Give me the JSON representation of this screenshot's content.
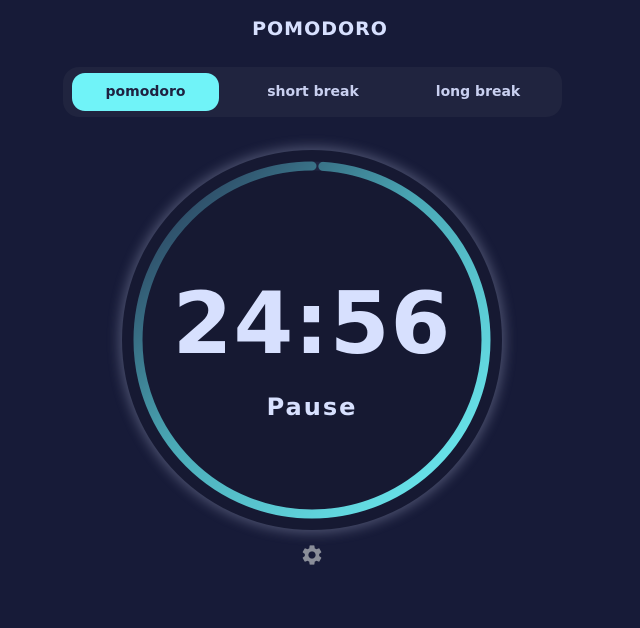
{
  "app": {
    "title": "POMODORO"
  },
  "tabs": [
    {
      "label": "pomodoro",
      "active": true
    },
    {
      "label": "short break",
      "active": false
    },
    {
      "label": "long break",
      "active": false
    }
  ],
  "timer": {
    "time": "24:56",
    "action_label": "Pause",
    "progress_fraction": 0.99
  },
  "icons": {
    "settings": "gear-icon"
  },
  "colors": {
    "background": "#171b38",
    "accent": "#70f3f8",
    "text": "#d7e0fe",
    "tab_bar": "#20243f"
  }
}
